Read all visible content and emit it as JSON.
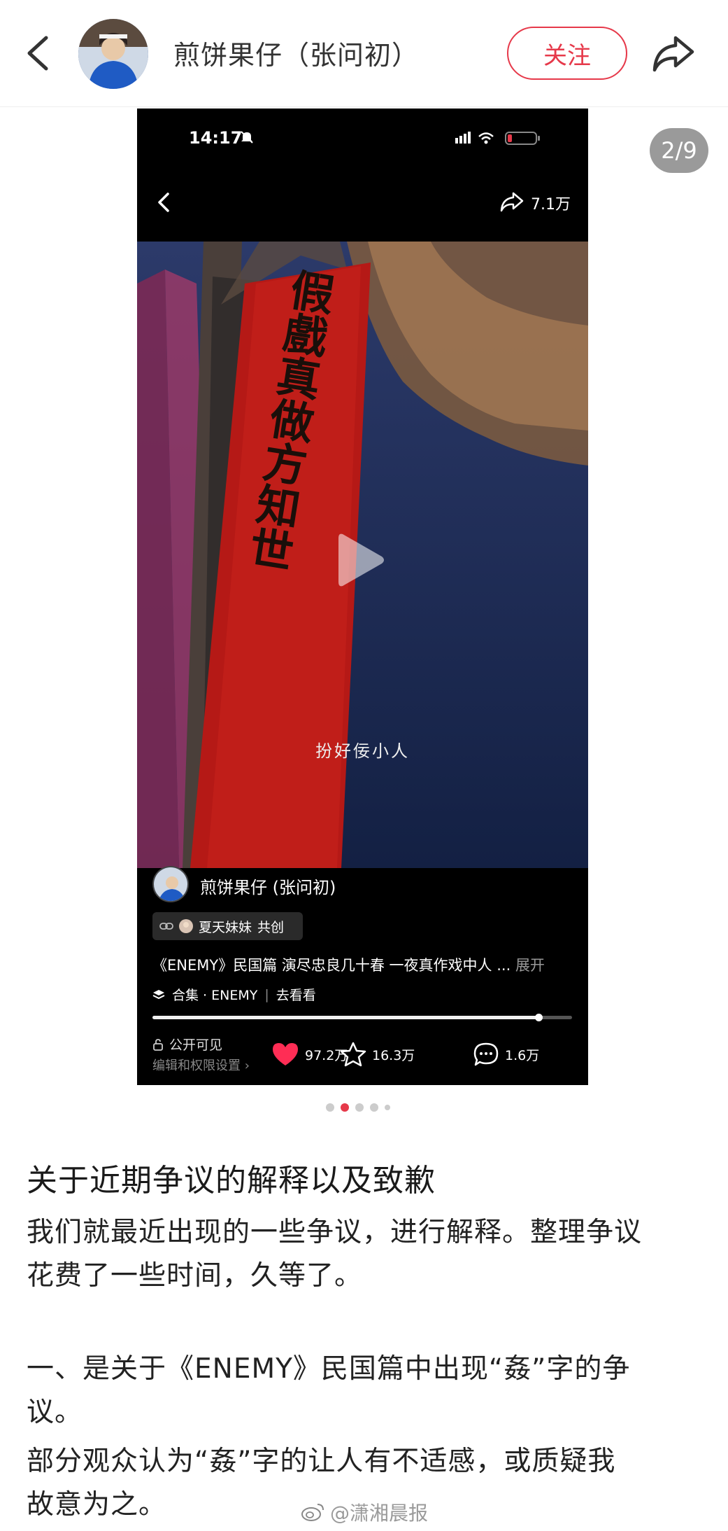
{
  "header": {
    "author_name": "煎饼果仔（张问初）",
    "follow_label": "关注"
  },
  "carousel": {
    "page_counter": "2/9",
    "current_index": 2,
    "total": 9
  },
  "phone": {
    "status_time": "14:17",
    "share_count": "7.1万",
    "video_subtitle": "扮好佞小人",
    "couplet_text": "假戲真做方知世",
    "author_name": "煎饼果仔 (张问初)",
    "collab_name": "夏天妹妹",
    "collab_tag": "共创",
    "caption": "《ENEMY》民国篇 演尽忠良几十春 一夜真作戏中人 ...",
    "expand_label": "展开",
    "collection_label": "合集 · ENEMY",
    "collection_link": "去看看",
    "progress": 0.92,
    "visibility": "公开可见",
    "edit_settings": "编辑和权限设置 ›",
    "likes": "97.2万",
    "favorites": "16.3万",
    "comments": "1.6万"
  },
  "article": {
    "title": "关于近期争议的解释以及致歉",
    "p1_line1": "我们就最近出现的一些争议，进行解释。整理争议",
    "p1_line2": "花费了一些时间，久等了。",
    "p2_line1": "一、是关于《ENEMY》民国篇中出现“姦”字的争",
    "p2_line2": "议。",
    "p3_line1": "部分观众认为“姦”字的让人有不适感，或质疑我",
    "p3_line2": "故意为之。"
  },
  "watermark": "@潇湘晨报",
  "colors": {
    "accent": "#e6394a",
    "like": "#ff2d55"
  }
}
